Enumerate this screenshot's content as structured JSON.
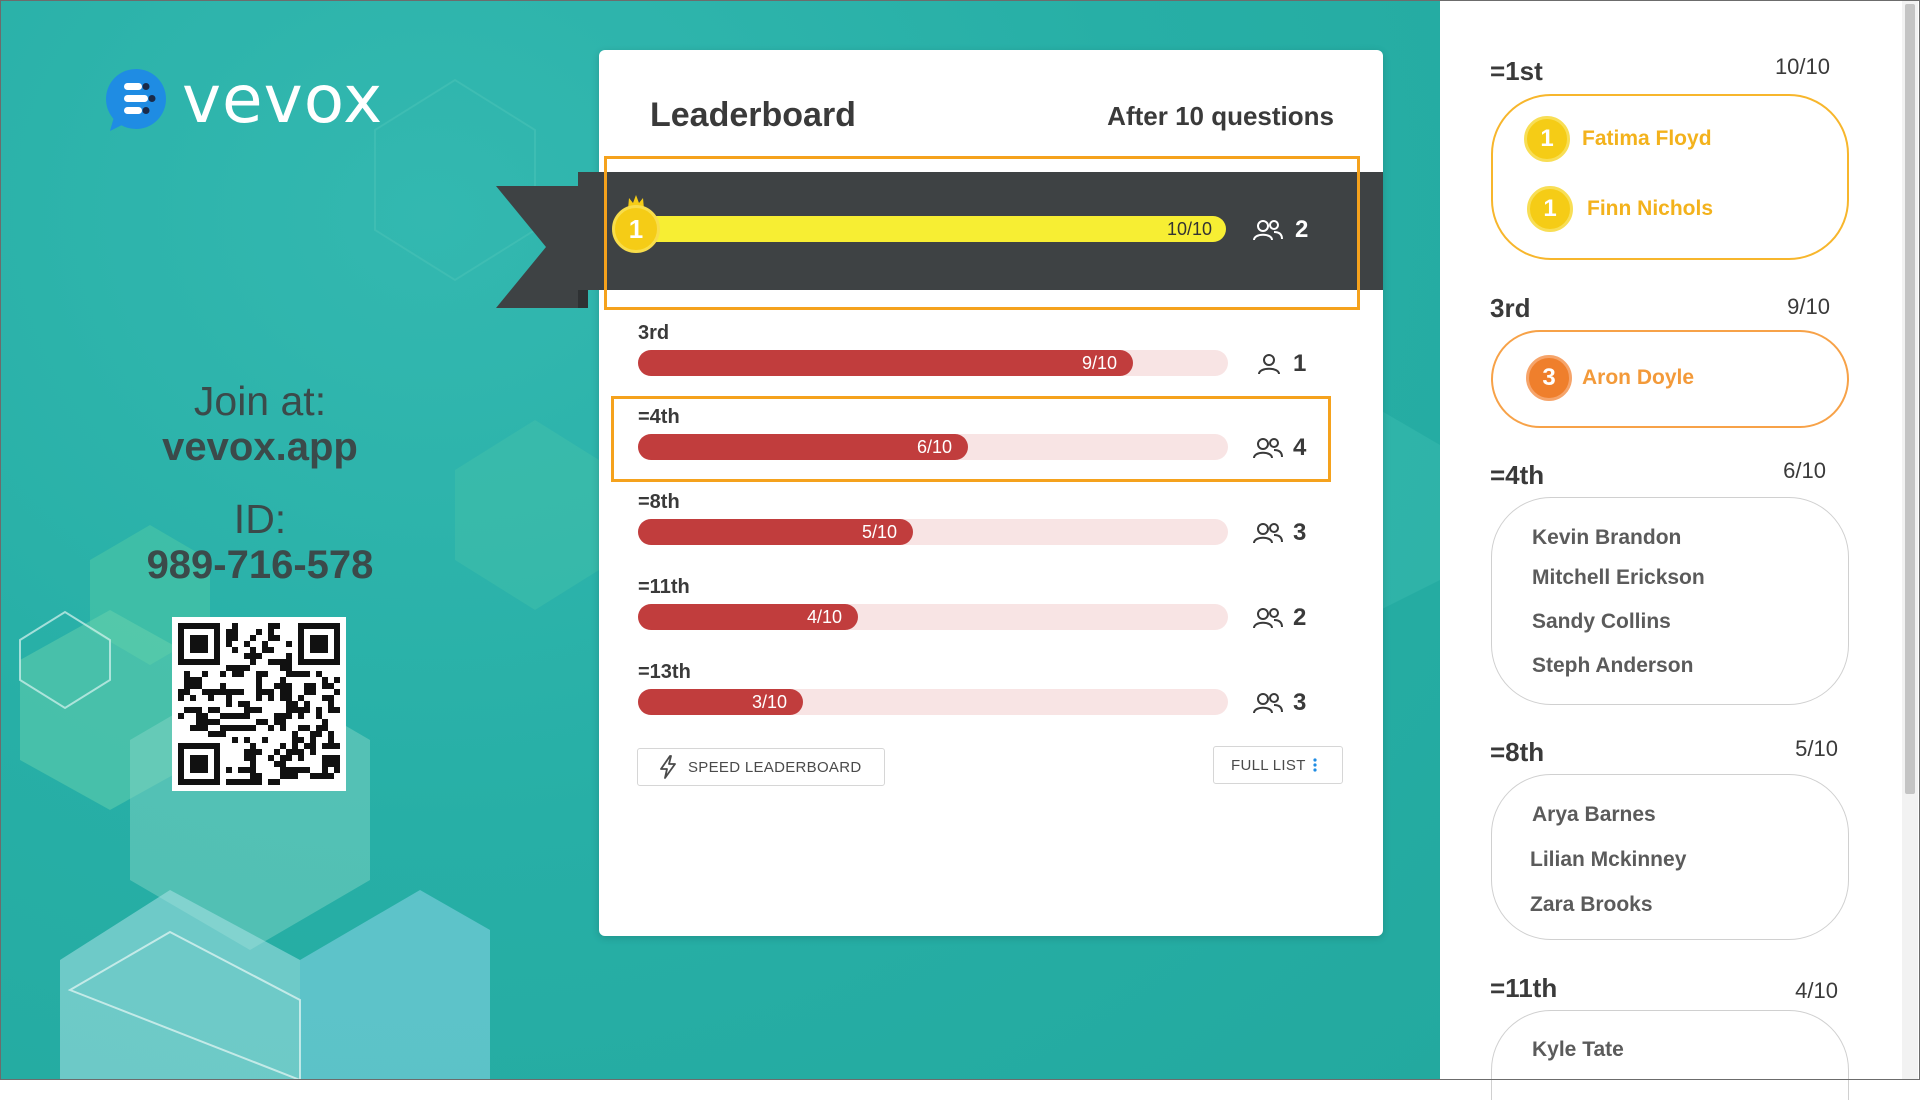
{
  "brand": {
    "name": "vevox"
  },
  "join": {
    "label": "Join at:",
    "url": "vevox.app",
    "id_label": "ID:",
    "id": "989-716-578"
  },
  "leaderboard": {
    "title": "Leaderboard",
    "subtitle": "After 10 questions",
    "top": {
      "medal": "1",
      "score": "10/10",
      "count": "2",
      "fraction": 1.0
    },
    "rows": [
      {
        "rank": "3rd",
        "score": "9/10",
        "count": "1",
        "fraction": 0.9
      },
      {
        "rank": "=4th",
        "score": "6/10",
        "count": "4",
        "fraction": 0.6
      },
      {
        "rank": "=8th",
        "score": "5/10",
        "count": "3",
        "fraction": 0.5
      },
      {
        "rank": "=11th",
        "score": "4/10",
        "count": "2",
        "fraction": 0.4
      },
      {
        "rank": "=13th",
        "score": "3/10",
        "count": "3",
        "fraction": 0.3
      }
    ],
    "speed_button": "SPEED LEADERBOARD",
    "full_list_button": "FULL LIST"
  },
  "side": {
    "groups": [
      {
        "rank": "=1st",
        "score": "10/10",
        "names": [
          "Fatima Floyd",
          "Finn Nichols"
        ],
        "medal": "1"
      },
      {
        "rank": "3rd",
        "score": "9/10",
        "names": [
          "Aron Doyle"
        ],
        "medal": "3"
      },
      {
        "rank": "=4th",
        "score": "6/10",
        "names": [
          "Kevin Brandon",
          "Mitchell Erickson",
          "Sandy Collins",
          "Steph Anderson"
        ]
      },
      {
        "rank": "=8th",
        "score": "5/10",
        "names": [
          "Arya Barnes",
          "Lilian Mckinney",
          "Zara Brooks"
        ]
      },
      {
        "rank": "=11th",
        "score": "4/10",
        "names": [
          "Kyle Tate"
        ]
      }
    ]
  },
  "colors": {
    "teal": "#2ab3aa",
    "ribbon": "#3e4244",
    "gold_bar": "#f7ee33",
    "red_bar": "#c13d3d",
    "track": "#f8e4e4",
    "highlight": "#f5a21d",
    "medal_gold": "#f5cc16",
    "medal_bronze": "#ef7f2c"
  }
}
